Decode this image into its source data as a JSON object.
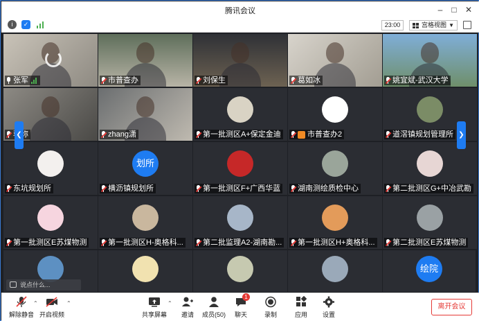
{
  "window": {
    "title": "腾讯会议"
  },
  "toolbar": {
    "time": "23:00",
    "view_label": "宫格视图"
  },
  "participants": [
    {
      "name": "张军",
      "mic": "on"
    },
    {
      "name": "市普查办",
      "mic": "muted"
    },
    {
      "name": "刘保生",
      "mic": "muted"
    },
    {
      "name": "葛如冰",
      "mic": "muted"
    },
    {
      "name": "姚宜斌-武汉大学",
      "mic": "muted"
    },
    {
      "name": "蒋弥",
      "mic": "muted"
    },
    {
      "name": "zhang潇",
      "mic": "muted"
    },
    {
      "name": "第一批测区A+保定金迪",
      "mic": "muted"
    },
    {
      "name": "市普查办2",
      "mic": "muted"
    },
    {
      "name": "道滘镇规划管理所",
      "mic": "muted"
    },
    {
      "name": "东坑规划所",
      "mic": "muted"
    },
    {
      "name": "横沥镇规划所",
      "mic": "muted",
      "avatar_text": "划所"
    },
    {
      "name": "第一批测区F+广西华蓝",
      "mic": "muted"
    },
    {
      "name": "湖南测绘质检中心",
      "mic": "muted"
    },
    {
      "name": "第二批测区G+中冶武勘",
      "mic": "muted"
    },
    {
      "name": "第一批测区E苏煤物测",
      "mic": "muted"
    },
    {
      "name": "第一批测区H-奥格科...",
      "mic": "muted"
    },
    {
      "name": "第二批监理A2-湖南勘...",
      "mic": "muted"
    },
    {
      "name": "第一批测区H+奥格科...",
      "mic": "muted"
    },
    {
      "name": "第二批测区E苏煤物测",
      "mic": "muted"
    },
    {
      "name": "",
      "mic": "none"
    },
    {
      "name": "",
      "mic": "none"
    },
    {
      "name": "",
      "mic": "none"
    },
    {
      "name": "",
      "mic": "none"
    },
    {
      "name": "",
      "mic": "none",
      "avatar_text": "绘院"
    }
  ],
  "chat": {
    "placeholder": "说点什么..."
  },
  "bottombar": {
    "unmute": "解除静音",
    "start_video": "开启视频",
    "share_screen": "共享屏幕",
    "invite": "邀请",
    "members": "成员(50)",
    "chat": "聊天",
    "chat_badge": "1",
    "record": "录制",
    "apps": "应用",
    "settings": "设置",
    "leave": "离开会议"
  },
  "colors": {
    "accent": "#1e7cf2",
    "danger": "#e53935",
    "stage": "#1e2025",
    "tile": "#2b2d33"
  }
}
